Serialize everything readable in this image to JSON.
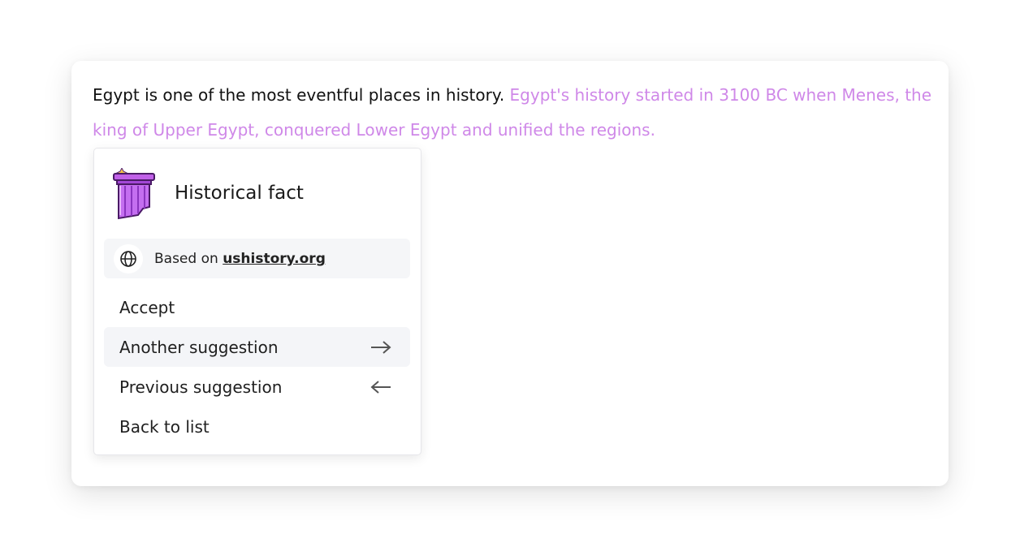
{
  "editor": {
    "plain_text": "Egypt is one of the most eventful places in history.",
    "suggested_text": "Egypt's history started in 3100 BC when Menes, the king of Upper Egypt, conquered Lower Egypt and unified the regions.",
    "suggestion_color": "#cf88e8"
  },
  "popup": {
    "title": "Historical fact",
    "icon": "greek-column-icon",
    "source": {
      "icon": "globe-icon",
      "prefix": "Based on",
      "link_text": "ushistory.org"
    },
    "menu": [
      {
        "label": "Accept"
      },
      {
        "label": "Another suggestion",
        "icon": "arrow-right-icon"
      },
      {
        "label": "Previous suggestion",
        "icon": "arrow-left-icon"
      },
      {
        "label": "Back to list"
      }
    ]
  }
}
